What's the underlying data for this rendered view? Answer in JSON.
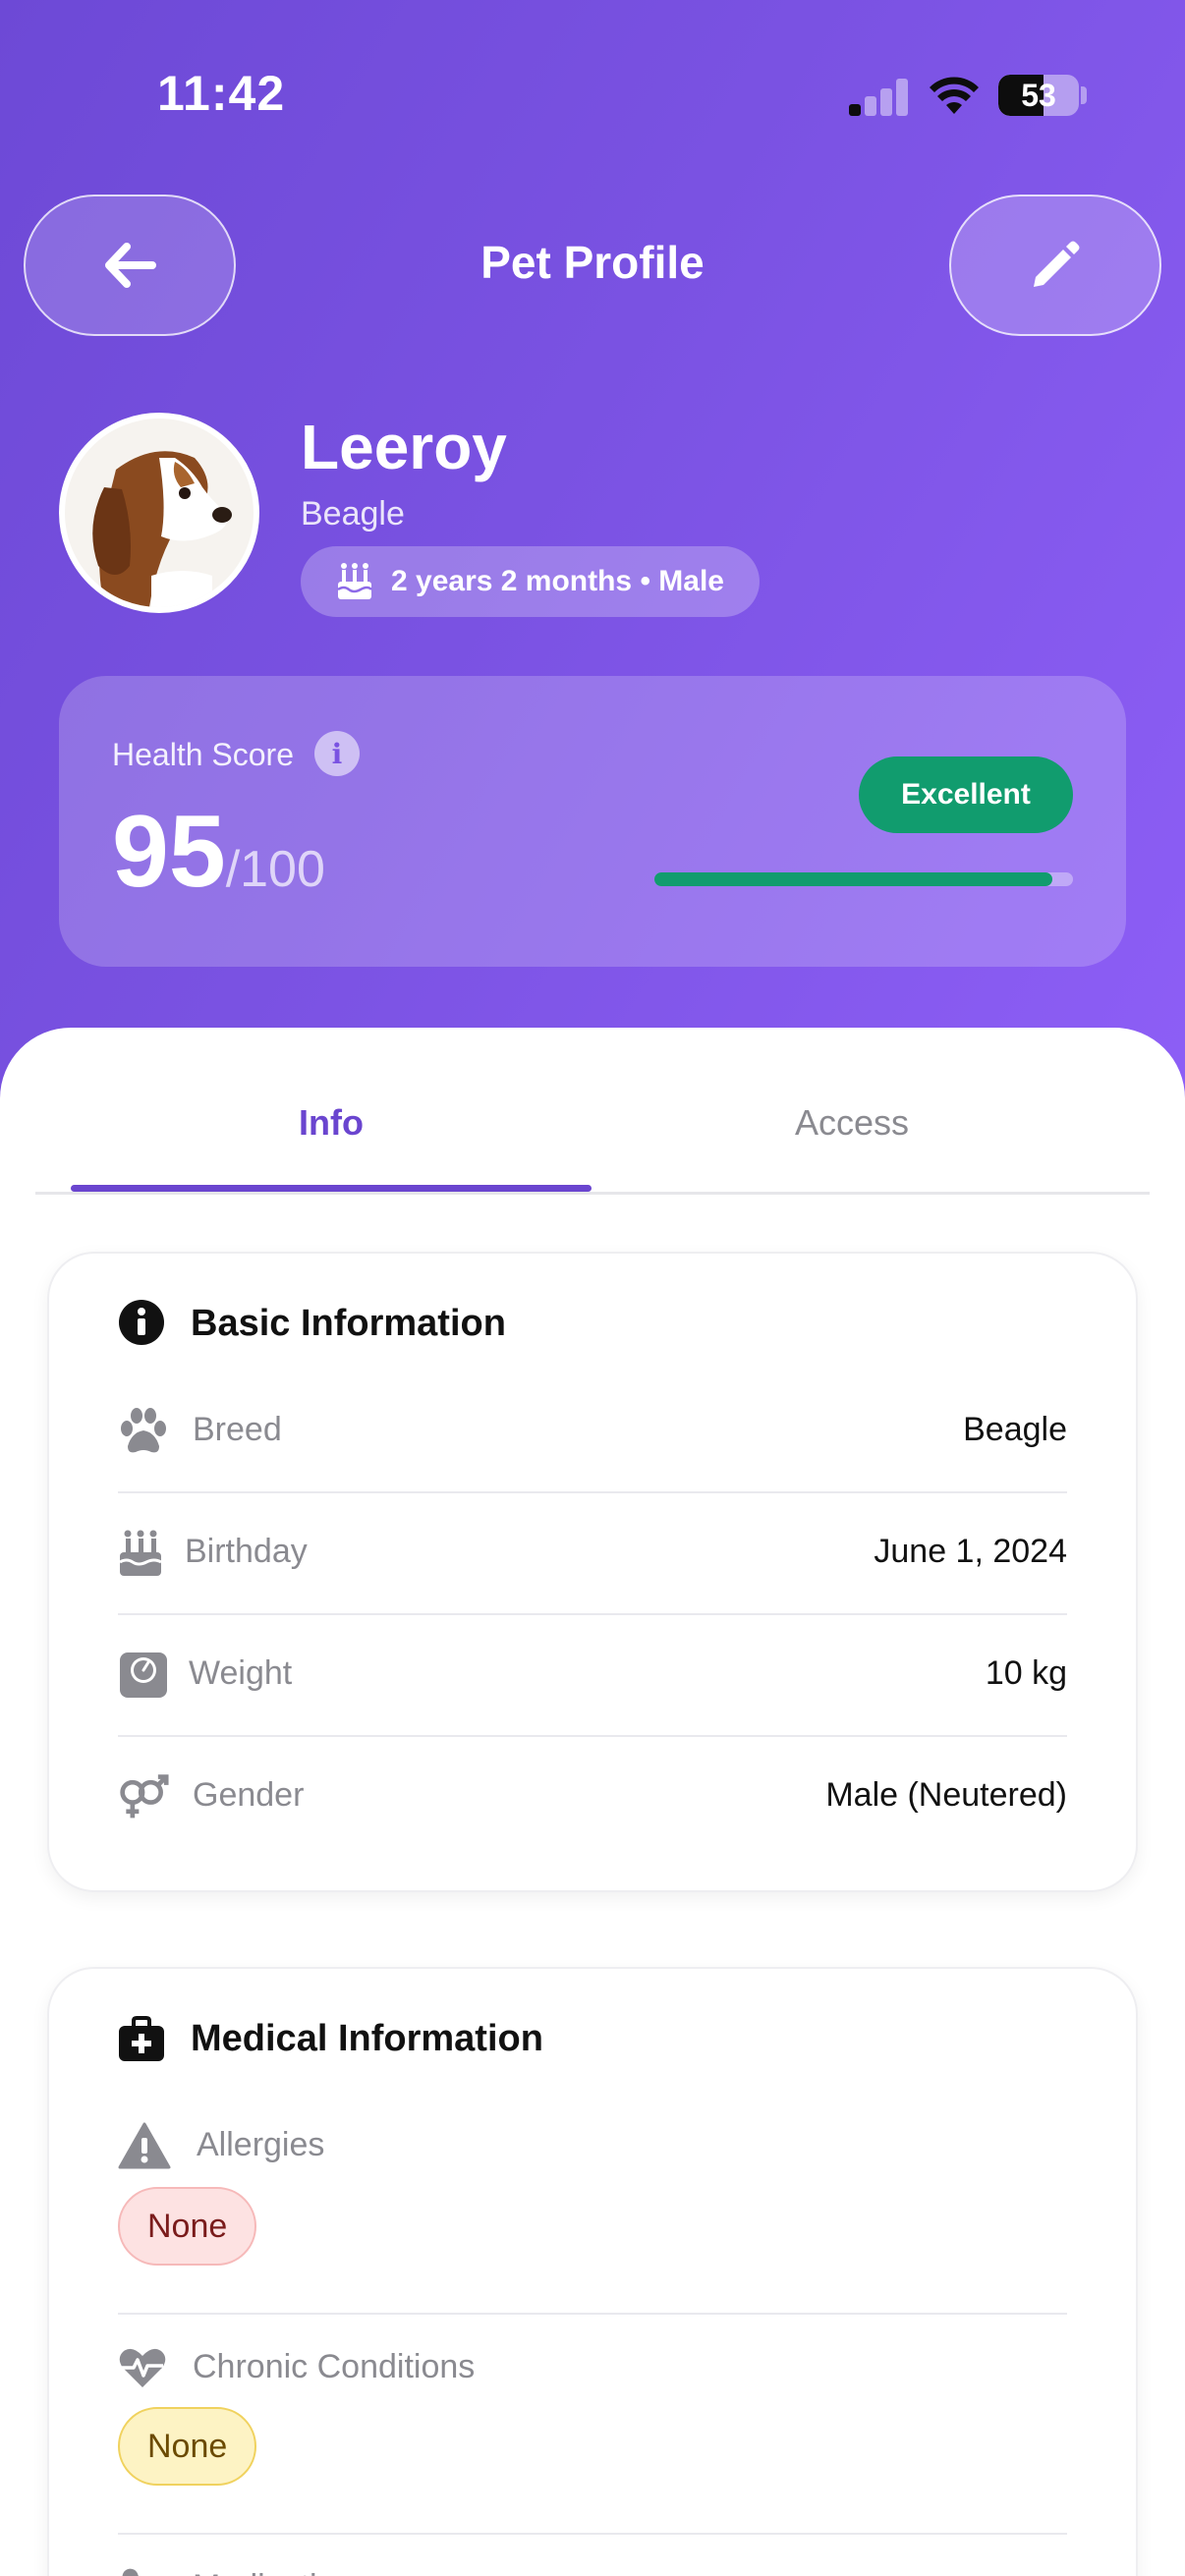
{
  "status_bar": {
    "time": "11:42",
    "battery": "53"
  },
  "header": {
    "title": "Pet Profile"
  },
  "pet": {
    "name": "Leeroy",
    "breed": "Beagle",
    "age_gender": "2 years 2 months • Male"
  },
  "health": {
    "label": "Health Score",
    "score": "95",
    "max": "/100",
    "status": "Excellent",
    "progress_fraction": 0.95,
    "status_color": "#119c6e"
  },
  "tabs": [
    {
      "label": "Info",
      "active": true
    },
    {
      "label": "Access",
      "active": false
    }
  ],
  "basic_info": {
    "title": "Basic Information",
    "rows": [
      {
        "icon": "paw-icon",
        "label": "Breed",
        "value": "Beagle"
      },
      {
        "icon": "birthday-cake-icon",
        "label": "Birthday",
        "value": "June 1, 2024"
      },
      {
        "icon": "weight-scale-icon",
        "label": "Weight",
        "value": "10 kg"
      },
      {
        "icon": "gender-icon",
        "label": "Gender",
        "value": "Male (Neutered)"
      }
    ]
  },
  "medical_info": {
    "title": "Medical Information",
    "allergies": {
      "label": "Allergies",
      "value": "None"
    },
    "chronic": {
      "label": "Chronic Conditions",
      "value": "None"
    },
    "medications": {
      "label": "Medications"
    }
  },
  "colors": {
    "accent": "#6a45cf",
    "hero_start": "#6d49d6",
    "hero_end": "#8d5ef6"
  }
}
